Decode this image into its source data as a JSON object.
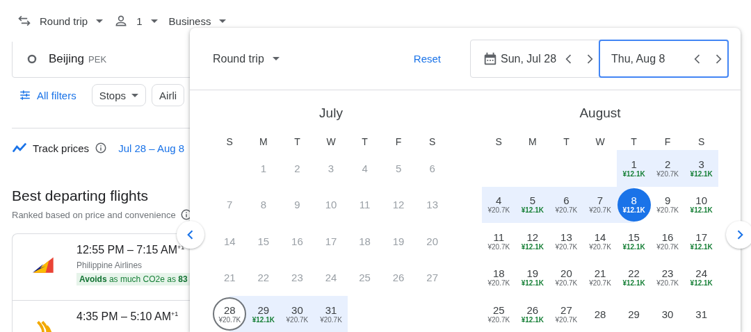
{
  "top_bar": {
    "trip_type": "Round trip",
    "passengers": "1",
    "cabin": "Business"
  },
  "origin": {
    "city": "Beijing",
    "code": "PEK"
  },
  "filters": {
    "all_filters": "All filters",
    "chips": [
      "Stops",
      "Airli"
    ]
  },
  "track": {
    "label": "Track prices",
    "dates": "Jul 28 – Aug 8"
  },
  "results": {
    "title": "Best departing flights",
    "subtitle": "Ranked based on price and convenience",
    "flights": [
      {
        "times": "12:55 PM – 7:15 AM$^{+1}$",
        "airline": "Philippine Airlines",
        "emissions": "**Avoids** as much CO2e as **83**"
      },
      {
        "times": "4:35 PM – 5:10 AM$^{+1}$"
      }
    ]
  },
  "date_picker": {
    "trip_type": "Round trip",
    "reset": "Reset",
    "departure": {
      "value": "Sun, Jul 28",
      "focused": false
    },
    "return": {
      "value": "Thu, Aug 8",
      "focused": true
    },
    "months": [
      {
        "name": "July",
        "weekdays": [
          "S",
          "M",
          "T",
          "W",
          "T",
          "F",
          "S"
        ],
        "days": [
          {
            "kind": "blank"
          },
          {
            "kind": "date",
            "day": "1",
            "disabled": true,
            "in_range": false,
            "selected": false
          },
          {
            "kind": "date",
            "day": "2",
            "disabled": true,
            "in_range": false,
            "selected": false
          },
          {
            "kind": "date",
            "day": "3",
            "disabled": true,
            "in_range": false,
            "selected": false
          },
          {
            "kind": "date",
            "day": "4",
            "disabled": true,
            "in_range": false,
            "selected": false
          },
          {
            "kind": "date",
            "day": "5",
            "disabled": true,
            "in_range": false,
            "selected": false
          },
          {
            "kind": "date",
            "day": "6",
            "disabled": true,
            "in_range": false,
            "selected": false
          },
          {
            "kind": "date",
            "day": "7",
            "disabled": true,
            "in_range": false,
            "selected": false
          },
          {
            "kind": "date",
            "day": "8",
            "disabled": true,
            "in_range": false,
            "selected": false
          },
          {
            "kind": "date",
            "day": "9",
            "disabled": true,
            "in_range": false,
            "selected": false
          },
          {
            "kind": "date",
            "day": "10",
            "disabled": true,
            "in_range": false,
            "selected": false
          },
          {
            "kind": "date",
            "day": "11",
            "disabled": true,
            "in_range": false,
            "selected": false
          },
          {
            "kind": "date",
            "day": "12",
            "disabled": true,
            "in_range": false,
            "selected": false
          },
          {
            "kind": "date",
            "day": "13",
            "disabled": true,
            "in_range": false,
            "selected": false
          },
          {
            "kind": "date",
            "day": "14",
            "disabled": true,
            "in_range": false,
            "selected": false
          },
          {
            "kind": "date",
            "day": "15",
            "disabled": true,
            "in_range": false,
            "selected": false
          },
          {
            "kind": "date",
            "day": "16",
            "disabled": true,
            "in_range": false,
            "selected": false
          },
          {
            "kind": "date",
            "day": "17",
            "disabled": true,
            "in_range": false,
            "selected": false
          },
          {
            "kind": "date",
            "day": "18",
            "disabled": true,
            "in_range": false,
            "selected": false
          },
          {
            "kind": "date",
            "day": "19",
            "disabled": true,
            "in_range": false,
            "selected": false
          },
          {
            "kind": "date",
            "day": "20",
            "disabled": true,
            "in_range": false,
            "selected": false
          },
          {
            "kind": "date",
            "day": "21",
            "disabled": true,
            "in_range": false,
            "selected": false
          },
          {
            "kind": "date",
            "day": "22",
            "disabled": true,
            "in_range": false,
            "selected": false
          },
          {
            "kind": "date",
            "day": "23",
            "disabled": true,
            "in_range": false,
            "selected": false
          },
          {
            "kind": "date",
            "day": "24",
            "disabled": true,
            "in_range": false,
            "selected": false
          },
          {
            "kind": "date",
            "day": "25",
            "disabled": true,
            "in_range": false,
            "selected": false
          },
          {
            "kind": "date",
            "day": "26",
            "disabled": true,
            "in_range": false,
            "selected": false
          },
          {
            "kind": "date",
            "day": "27",
            "disabled": true,
            "in_range": false,
            "selected": false
          },
          {
            "kind": "date",
            "day": "28",
            "price": "¥20.7K",
            "cheap": false,
            "disabled": false,
            "in_range": true,
            "selected": true
          },
          {
            "kind": "date",
            "day": "29",
            "price": "¥12.1K",
            "cheap": true,
            "disabled": false,
            "in_range": true,
            "selected": false
          },
          {
            "kind": "date",
            "day": "30",
            "price": "¥20.7K",
            "cheap": false,
            "disabled": false,
            "in_range": true,
            "selected": false
          },
          {
            "kind": "date",
            "day": "31",
            "price": "¥20.7K",
            "cheap": false,
            "disabled": false,
            "in_range": true,
            "selected": false
          }
        ]
      },
      {
        "name": "August",
        "weekdays": [
          "S",
          "M",
          "T",
          "W",
          "T",
          "F",
          "S"
        ],
        "days": [
          {
            "kind": "blank"
          },
          {
            "kind": "blank"
          },
          {
            "kind": "blank"
          },
          {
            "kind": "blank"
          },
          {
            "kind": "date",
            "day": "1",
            "price": "¥12.1K",
            "cheap": true,
            "disabled": false,
            "in_range": true,
            "selected": false
          },
          {
            "kind": "date",
            "day": "2",
            "price": "¥20.7K",
            "cheap": false,
            "disabled": false,
            "in_range": true,
            "selected": false
          },
          {
            "kind": "date",
            "day": "3",
            "price": "¥12.1K",
            "cheap": true,
            "disabled": false,
            "in_range": true,
            "selected": false
          },
          {
            "kind": "date",
            "day": "4",
            "price": "¥20.7K",
            "cheap": false,
            "disabled": false,
            "in_range": true,
            "selected": false
          },
          {
            "kind": "date",
            "day": "5",
            "price": "¥12.1K",
            "cheap": true,
            "disabled": false,
            "in_range": true,
            "selected": false
          },
          {
            "kind": "date",
            "day": "6",
            "price": "¥20.7K",
            "cheap": false,
            "disabled": false,
            "in_range": true,
            "selected": false
          },
          {
            "kind": "date",
            "day": "7",
            "price": "¥20.7K",
            "cheap": false,
            "disabled": false,
            "in_range": true,
            "selected": false
          },
          {
            "kind": "date",
            "day": "8",
            "price": "¥12.1K",
            "cheap": true,
            "disabled": false,
            "in_range": true,
            "selected": true
          },
          {
            "kind": "date",
            "day": "9",
            "price": "¥20.7K",
            "cheap": false,
            "disabled": false,
            "in_range": false,
            "selected": false
          },
          {
            "kind": "date",
            "day": "10",
            "price": "¥12.1K",
            "cheap": true,
            "disabled": false,
            "in_range": false,
            "selected": false
          },
          {
            "kind": "date",
            "day": "11",
            "price": "¥20.7K",
            "cheap": false,
            "disabled": false,
            "in_range": false,
            "selected": false
          },
          {
            "kind": "date",
            "day": "12",
            "price": "¥12.1K",
            "cheap": true,
            "disabled": false,
            "in_range": false,
            "selected": false
          },
          {
            "kind": "date",
            "day": "13",
            "price": "¥20.7K",
            "cheap": false,
            "disabled": false,
            "in_range": false,
            "selected": false
          },
          {
            "kind": "date",
            "day": "14",
            "price": "¥20.7K",
            "cheap": false,
            "disabled": false,
            "in_range": false,
            "selected": false
          },
          {
            "kind": "date",
            "day": "15",
            "price": "¥12.1K",
            "cheap": true,
            "disabled": false,
            "in_range": false,
            "selected": false
          },
          {
            "kind": "date",
            "day": "16",
            "price": "¥20.7K",
            "cheap": false,
            "disabled": false,
            "in_range": false,
            "selected": false
          },
          {
            "kind": "date",
            "day": "17",
            "price": "¥12.1K",
            "cheap": true,
            "disabled": false,
            "in_range": false,
            "selected": false
          },
          {
            "kind": "date",
            "day": "18",
            "price": "¥20.7K",
            "cheap": false,
            "disabled": false,
            "in_range": false,
            "selected": false
          },
          {
            "kind": "date",
            "day": "19",
            "price": "¥12.1K",
            "cheap": true,
            "disabled": false,
            "in_range": false,
            "selected": false
          },
          {
            "kind": "date",
            "day": "20",
            "price": "¥20.7K",
            "cheap": false,
            "disabled": false,
            "in_range": false,
            "selected": false
          },
          {
            "kind": "date",
            "day": "21",
            "price": "¥20.7K",
            "cheap": false,
            "disabled": false,
            "in_range": false,
            "selected": false
          },
          {
            "kind": "date",
            "day": "22",
            "price": "¥12.1K",
            "cheap": true,
            "disabled": false,
            "in_range": false,
            "selected": false
          },
          {
            "kind": "date",
            "day": "23",
            "price": "¥20.7K",
            "cheap": false,
            "disabled": false,
            "in_range": false,
            "selected": false
          },
          {
            "kind": "date",
            "day": "24",
            "price": "¥12.1K",
            "cheap": true,
            "disabled": false,
            "in_range": false,
            "selected": false
          },
          {
            "kind": "date",
            "day": "25",
            "price": "¥20.7K",
            "cheap": false,
            "disabled": false,
            "in_range": false,
            "selected": false
          },
          {
            "kind": "date",
            "day": "26",
            "price": "¥12.1K",
            "cheap": true,
            "disabled": false,
            "in_range": false,
            "selected": false
          },
          {
            "kind": "date",
            "day": "27",
            "price": "¥20.7K",
            "cheap": false,
            "disabled": false,
            "in_range": false,
            "selected": false
          },
          {
            "kind": "date",
            "day": "28",
            "disabled": false,
            "in_range": false,
            "selected": false
          },
          {
            "kind": "date",
            "day": "29",
            "disabled": false,
            "in_range": false,
            "selected": false
          },
          {
            "kind": "date",
            "day": "30",
            "disabled": false,
            "in_range": false,
            "selected": false
          },
          {
            "kind": "date",
            "day": "31",
            "disabled": false,
            "in_range": false,
            "selected": false
          }
        ]
      }
    ]
  }
}
